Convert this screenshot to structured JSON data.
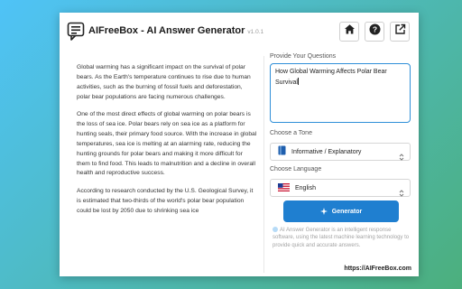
{
  "app": {
    "title": "AIFreeBox - AI Answer Generator",
    "version": "v1.0.1",
    "logo_icon": "chat-bubble-icon"
  },
  "header": {
    "buttons": [
      {
        "name": "home-button",
        "icon": "home-icon"
      },
      {
        "name": "help-button",
        "icon": "question-icon"
      },
      {
        "name": "open-external-button",
        "icon": "external-link-icon"
      }
    ]
  },
  "article": {
    "paragraphs": [
      "Global warming has a significant impact on the survival of polar bears. As the Earth's temperature continues to rise due to human activities, such as the burning of fossil fuels and deforestation, polar bear populations are facing numerous challenges.",
      "One of the most direct effects of global warming on polar bears is the loss of sea ice. Polar bears rely on sea ice as a platform for hunting seals, their primary food source. With the increase in global temperatures, sea ice is melting at an alarming rate, reducing the hunting grounds for polar bears and making it more difficult for them to find food. This leads to malnutrition and a decline in overall health and reproductive success.",
      "According to research conducted by the U.S. Geological Survey, it is estimated that two-thirds of the world's polar bear population could be lost by 2050 due to shrinking sea ice"
    ]
  },
  "form": {
    "question_label": "Provide Your Questions",
    "question_value": "How Global Warming Affects Polar Bear Survival",
    "tone_label": "Choose a Tone",
    "tone_value": "Informative / Explanatory",
    "tone_icon": "book-icon",
    "language_label": "Choose Language",
    "language_value": "English",
    "language_icon": "us-flag-icon",
    "generate_label": "Generator",
    "note": "AI Answer Generator is an intelligent response software, using the latest machine learning technology to provide quick and accurate answers."
  },
  "footer": {
    "link": "https://AIFreeBox.com"
  },
  "colors": {
    "accent": "#1f7fd0",
    "focus_border": "#2f8fd8",
    "background_start": "#4fc3f7",
    "background_end": "#4caf7d"
  }
}
